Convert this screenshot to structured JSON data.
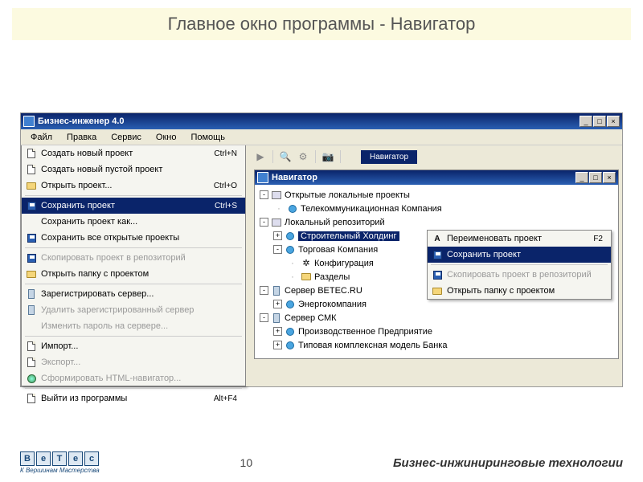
{
  "slide": {
    "title": "Главное окно программы - Навигатор",
    "page": "10",
    "brand": "Бизнес-инжиниринговые технологии",
    "logo_sub": "К Вершинам Мастерства",
    "logo_letters": [
      "B",
      "e",
      "T",
      "e",
      "c"
    ]
  },
  "app": {
    "title": "Бизнес-инженер 4.0",
    "menubar": [
      "Файл",
      "Правка",
      "Сервис",
      "Окно",
      "Помощь"
    ],
    "nav_tag": "Навигатор"
  },
  "file_menu": {
    "items": [
      {
        "label": "Создать новый проект",
        "shortcut": "Ctrl+N",
        "ico": "doc"
      },
      {
        "label": "Создать новый пустой проект",
        "shortcut": "",
        "ico": "doc"
      },
      {
        "label": "Открыть проект...",
        "shortcut": "Ctrl+O",
        "ico": "folder"
      },
      {
        "sep": true
      },
      {
        "label": "Сохранить проект",
        "shortcut": "Ctrl+S",
        "ico": "save",
        "sel": true
      },
      {
        "label": "Сохранить проект как...",
        "shortcut": "",
        "ico": ""
      },
      {
        "label": "Сохранить все открытые проекты",
        "shortcut": "",
        "ico": "save"
      },
      {
        "sep": true
      },
      {
        "label": "Скопировать проект в репозиторий",
        "shortcut": "",
        "ico": "save",
        "disabled": true
      },
      {
        "label": "Открыть папку с проектом",
        "shortcut": "",
        "ico": "folder"
      },
      {
        "sep": true
      },
      {
        "label": "Зарегистрировать сервер...",
        "shortcut": "",
        "ico": "server"
      },
      {
        "label": "Удалить зарегистрированный сервер",
        "shortcut": "",
        "ico": "server",
        "disabled": true
      },
      {
        "label": "Изменить пароль на сервере...",
        "shortcut": "",
        "ico": "",
        "disabled": true
      },
      {
        "sep": true
      },
      {
        "label": "Импорт...",
        "shortcut": "",
        "ico": "doc"
      },
      {
        "label": "Экспорт...",
        "shortcut": "",
        "ico": "doc",
        "disabled": true
      },
      {
        "label": "Сформировать HTML-навигатор...",
        "shortcut": "",
        "ico": "globe",
        "disabled": true
      },
      {
        "sep": true
      },
      {
        "label": "Выйти из программы",
        "shortcut": "Alt+F4",
        "ico": "doc"
      }
    ]
  },
  "child": {
    "title": "Навигатор"
  },
  "tree": {
    "rows": [
      {
        "indent": 0,
        "toggle": "-",
        "ico": "pc",
        "label": "Открытые локальные проекты"
      },
      {
        "indent": 1,
        "conn": true,
        "ico": "db",
        "label": "Телекоммуникационная Компания"
      },
      {
        "indent": 0,
        "toggle": "-",
        "ico": "pc",
        "label": "Локальный репозиторий"
      },
      {
        "indent": 1,
        "toggle": "+",
        "ico": "db",
        "label": "Строительный Холдинг",
        "sel": true
      },
      {
        "indent": 1,
        "toggle": "-",
        "ico": "db",
        "label": "Торговая Компания"
      },
      {
        "indent": 2,
        "conn": true,
        "ico": "gear",
        "label": "Конфигурация"
      },
      {
        "indent": 2,
        "conn": true,
        "ico": "folder",
        "label": "Разделы"
      },
      {
        "indent": 0,
        "toggle": "-",
        "ico": "server",
        "label": "Сервер BETEC.RU"
      },
      {
        "indent": 1,
        "toggle": "+",
        "ico": "db",
        "label": "Энергокомпания"
      },
      {
        "indent": 0,
        "toggle": "-",
        "ico": "server",
        "label": "Сервер СМК"
      },
      {
        "indent": 1,
        "toggle": "+",
        "ico": "db",
        "label": "Производственное Предприятие"
      },
      {
        "indent": 1,
        "toggle": "+",
        "ico": "db",
        "label": "Типовая комплексная модель Банка"
      }
    ]
  },
  "context": {
    "items": [
      {
        "label": "Переименовать проект",
        "shortcut": "F2",
        "ico": "A"
      },
      {
        "label": "Сохранить проект",
        "shortcut": "",
        "ico": "save",
        "sel": true
      },
      {
        "sep": true
      },
      {
        "label": "Скопировать проект в репозиторий",
        "shortcut": "",
        "ico": "save",
        "disabled": true
      },
      {
        "label": "Открыть папку с проектом",
        "shortcut": "",
        "ico": "folder"
      }
    ]
  }
}
